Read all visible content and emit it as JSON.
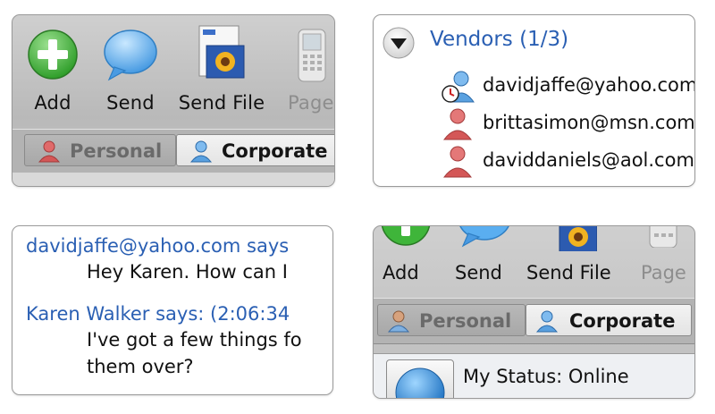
{
  "toolbar": {
    "add_label": "Add",
    "send_label": "Send",
    "send_file_label": "Send File",
    "page_label": "Page"
  },
  "tabs": {
    "personal_label": "Personal",
    "corporate_label": "Corporate"
  },
  "contacts": {
    "group_title": "Vendors (1/3)",
    "items": [
      {
        "email": "davidjaffe@yahoo.com",
        "status_icon": "away-clock-user-icon"
      },
      {
        "email": "brittasimon@msn.com",
        "status_icon": "offline-user-icon"
      },
      {
        "email": "daviddaniels@aol.com",
        "status_icon": "offline-user-icon"
      }
    ]
  },
  "chat": {
    "messages": [
      {
        "speaker": "davidjaffe@yahoo.com says",
        "lines": [
          "Hey Karen.  How can I"
        ]
      },
      {
        "speaker": "Karen Walker says: (2:06:34",
        "lines": [
          "I've got a few things fo",
          "them over?"
        ]
      }
    ]
  },
  "status": {
    "text": "My Status: Online"
  },
  "colors": {
    "link_blue": "#2a5fb3",
    "toolbar_gray": "#c4c4c4",
    "add_green": "#3fb53a",
    "bubble_blue": "#5aaef0"
  },
  "icons": [
    "add-icon",
    "send-bubble-icon",
    "send-file-icon",
    "pager-icon",
    "disclosure-triangle-icon",
    "personal-user-icon",
    "corporate-user-icon",
    "status-orb-icon"
  ]
}
